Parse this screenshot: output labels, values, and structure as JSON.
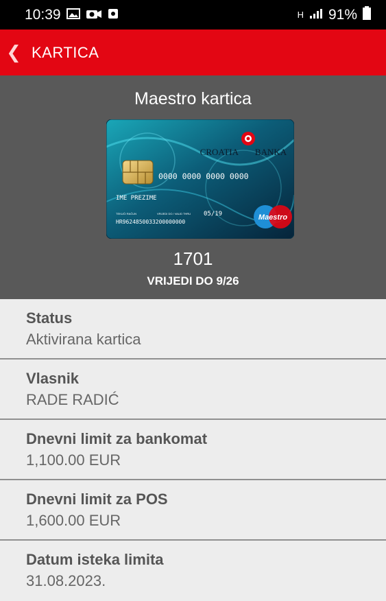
{
  "status_bar": {
    "time": "10:39",
    "signal_text": "H",
    "battery": "91%"
  },
  "app_bar": {
    "title": "KARTICA"
  },
  "card": {
    "heading": "Maestro kartica",
    "bank_name_left": "CROATIA",
    "bank_name_right": "BANKA",
    "card_number": "0000 0000 0000 0000",
    "holder": "IME PREZIME",
    "account_label": "TEKUĆI RAČUN",
    "valid_label": "VRIJEDI DO / VALID THRU",
    "valid_thru": "05/19",
    "iban": "HR9624850033200000000",
    "brand": "Maestro",
    "last_digits": "1701",
    "valid_until": "VRIJEDI DO 9/26"
  },
  "details": [
    {
      "label": "Status",
      "value": "Aktivirana kartica"
    },
    {
      "label": "Vlasnik",
      "value": "RADE RADIĆ"
    },
    {
      "label": "Dnevni limit za bankomat",
      "value": "1,100.00 EUR"
    },
    {
      "label": "Dnevni limit za POS",
      "value": "1,600.00 EUR"
    },
    {
      "label": "Datum isteka limita",
      "value": "31.08.2023."
    }
  ],
  "colors": {
    "accent": "#e30613",
    "header_bg": "#595959",
    "list_bg": "#ededed"
  }
}
